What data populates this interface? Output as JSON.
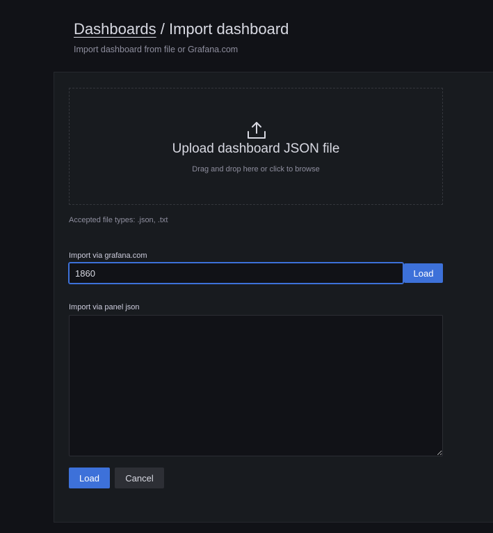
{
  "header": {
    "breadcrumb_link": "Dashboards",
    "breadcrumb_separator": " / ",
    "breadcrumb_current": "Import dashboard",
    "subtitle": "Import dashboard from file or Grafana.com"
  },
  "upload": {
    "icon": "upload-icon",
    "title": "Upload dashboard JSON file",
    "hint": "Drag and drop here or click to browse",
    "accepted_types": "Accepted file types: .json, .txt"
  },
  "grafana_com": {
    "label": "Import via grafana.com",
    "value": "1860",
    "load_label": "Load"
  },
  "panel_json": {
    "label": "Import via panel json",
    "value": ""
  },
  "actions": {
    "load_label": "Load",
    "cancel_label": "Cancel"
  },
  "colors": {
    "background": "#111217",
    "panel": "#181b1f",
    "primary": "#3d71d9",
    "secondary": "#2d2f35"
  }
}
